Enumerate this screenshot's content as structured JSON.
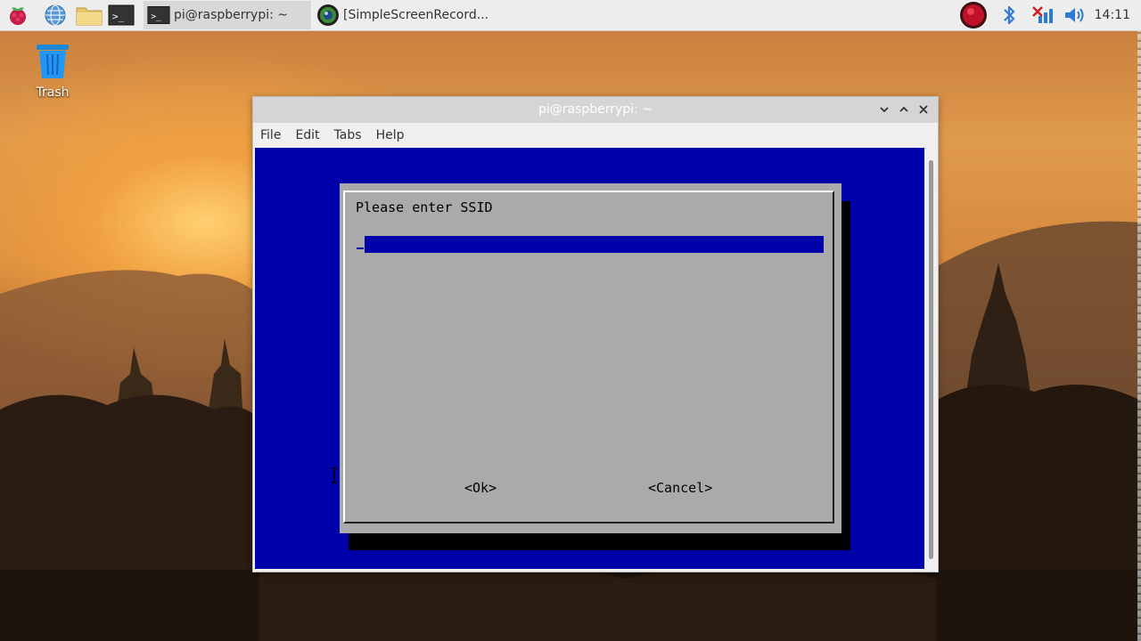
{
  "colors": {
    "terminal_bg": "#0000aa",
    "dialog_bg": "#aaaaaa",
    "taskbar_bg": "#ededed",
    "titlebar_bg": "#d5d5d5"
  },
  "taskbar": {
    "launchers": [
      {
        "icon": "raspberry-pi-menu-icon"
      },
      {
        "icon": "web-browser-globe-icon"
      },
      {
        "icon": "file-manager-folder-icon"
      },
      {
        "icon": "terminal-icon"
      }
    ],
    "tasks": [
      {
        "label": "pi@raspberrypi: ~",
        "icon": "terminal-icon",
        "active": true
      },
      {
        "label": "[SimpleScreenRecord...",
        "icon": "screen-recorder-icon",
        "active": false
      }
    ],
    "tray": {
      "icons": [
        "record-icon",
        "bluetooth-icon",
        "network-disconnected-icon",
        "volume-icon"
      ],
      "clock": "14:11"
    }
  },
  "desktop": {
    "trash_label": "Trash"
  },
  "window": {
    "title": "pi@raspberrypi: ~",
    "menu": [
      "File",
      "Edit",
      "Tabs",
      "Help"
    ],
    "controls": [
      "minimize-icon",
      "maximize-icon",
      "close-icon"
    ]
  },
  "dialog": {
    "prompt": "Please enter SSID",
    "input_value": "",
    "ok_label": "<Ok>",
    "cancel_label": "<Cancel>"
  }
}
